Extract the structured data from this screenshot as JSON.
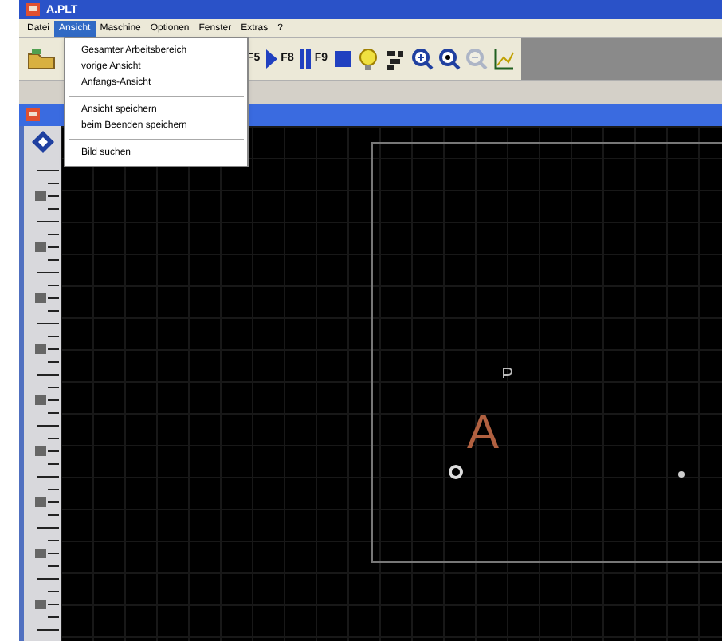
{
  "window": {
    "title": "A.PLT"
  },
  "menubar": [
    {
      "label": "Datei",
      "selected": false
    },
    {
      "label": "Ansicht",
      "selected": true
    },
    {
      "label": "Maschine",
      "selected": false
    },
    {
      "label": "Optionen",
      "selected": false
    },
    {
      "label": "Fenster",
      "selected": false
    },
    {
      "label": "Extras",
      "selected": false
    },
    {
      "label": "?",
      "selected": false
    }
  ],
  "dropdown": [
    {
      "kind": "item",
      "label": "Gesamter Arbeitsbereich"
    },
    {
      "kind": "item",
      "label": "vorige Ansicht"
    },
    {
      "kind": "item",
      "label": "Anfangs-Ansicht"
    },
    {
      "kind": "separator"
    },
    {
      "kind": "item",
      "label": "Ansicht speichern"
    },
    {
      "kind": "item",
      "label": "beim Beenden speichern"
    },
    {
      "kind": "separator"
    },
    {
      "kind": "item",
      "label": "Bild suchen"
    }
  ],
  "toolbar": [
    {
      "kind": "key",
      "label": "F5"
    },
    {
      "kind": "play",
      "label": "F8"
    },
    {
      "kind": "pause",
      "label": "F9"
    },
    {
      "kind": "stop"
    },
    {
      "kind": "bulb"
    },
    {
      "kind": "tool"
    },
    {
      "kind": "zoom-in"
    },
    {
      "kind": "zoom"
    },
    {
      "kind": "zoom-out",
      "disabled": true
    },
    {
      "kind": "chart"
    }
  ],
  "canvas": {
    "letter": "A"
  }
}
